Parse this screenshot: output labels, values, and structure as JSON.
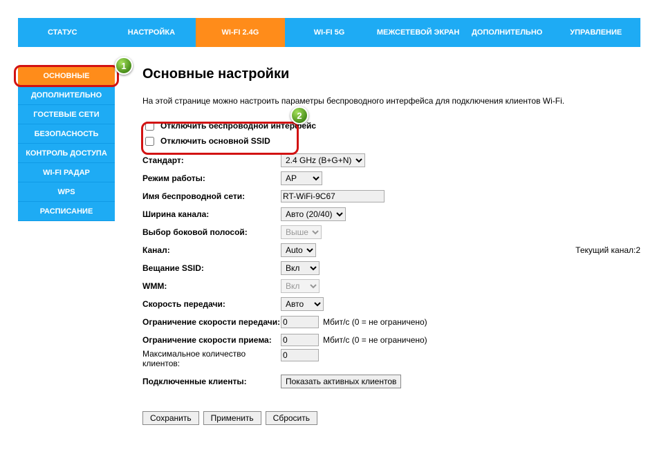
{
  "topnav": {
    "items": [
      {
        "label": "СТАТУС"
      },
      {
        "label": "НАСТРОЙКА"
      },
      {
        "label": "WI-FI 2.4G"
      },
      {
        "label": "WI-FI 5G"
      },
      {
        "label": "МЕЖСЕТЕВОЙ ЭКРАН"
      },
      {
        "label": "ДОПОЛНИТЕЛЬНО"
      },
      {
        "label": "УПРАВЛЕНИЕ"
      }
    ],
    "activeIndex": 2
  },
  "sidebar": {
    "items": [
      {
        "label": "ОСНОВНЫЕ"
      },
      {
        "label": "ДОПОЛНИТЕЛЬНО"
      },
      {
        "label": "ГОСТЕВЫЕ СЕТИ"
      },
      {
        "label": "БЕЗОПАСНОСТЬ"
      },
      {
        "label": "КОНТРОЛЬ ДОСТУПА"
      },
      {
        "label": "WI-FI РАДАР"
      },
      {
        "label": "WPS"
      },
      {
        "label": "РАСПИСАНИЕ"
      }
    ],
    "activeIndex": 0
  },
  "page": {
    "title": "Основные настройки",
    "intro": "На этой странице можно настроить параметры беспроводного интерфейса для подключения клиентов Wi-Fi."
  },
  "form": {
    "disable_wlan_label": "Отключить беспроводной интерфейс",
    "disable_ssid_label": "Отключить основной SSID",
    "band_label": "Стандарт:",
    "band_value": "2.4 GHz (B+G+N)",
    "mode_label": "Режим работы:",
    "mode_value": "AP",
    "ssid_label": "Имя беспроводной сети:",
    "ssid_value": "RT-WiFi-9C67",
    "chwidth_label": "Ширина канала:",
    "chwidth_value": "Авто (20/40)",
    "sideband_label": "Выбор боковой полосой:",
    "sideband_value": "Выше",
    "channel_label": "Канал:",
    "channel_value": "Auto",
    "channel_current": "Текущий канал:2",
    "bcast_label": "Вещание SSID:",
    "bcast_value": "Вкл",
    "wmm_label": "WMM:",
    "wmm_value": "Вкл",
    "txrate_label": "Скорость передачи:",
    "txrate_value": "Авто",
    "txlimit_label": "Ограничение скорости передачи:",
    "txlimit_value": "0",
    "rxlimit_label": "Ограничение скорости приема:",
    "rxlimit_value": "0",
    "limit_unit": "Мбит/с (0 = не ограничено)",
    "maxclients_label": "Максимальное количество клиентов:",
    "maxclients_value": "0",
    "clients_label": "Подключенные клиенты:",
    "clients_button": "Показать активных клиентов"
  },
  "buttons": {
    "save": "Сохранить",
    "apply": "Применить",
    "reset": "Сбросить"
  },
  "annotations": {
    "n1": "1",
    "n2": "2"
  }
}
